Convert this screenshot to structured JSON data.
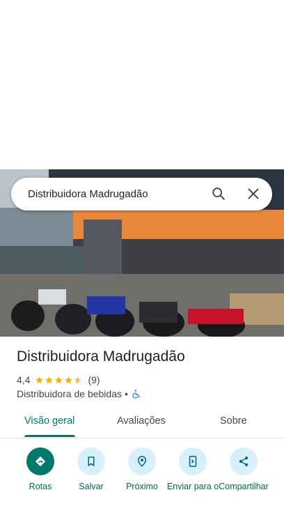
{
  "search": {
    "query": "Distribuidora Madrugadão"
  },
  "place": {
    "title": "Distribuidora Madrugadão",
    "rating_value": "4,4",
    "rating_stars": 4.4,
    "review_count": "(9)",
    "category": "Distribuidora de bebidas",
    "separator": "•"
  },
  "tabs": [
    {
      "label": "Visão geral",
      "active": true
    },
    {
      "label": "Avaliações",
      "active": false
    },
    {
      "label": "Sobre",
      "active": false
    }
  ],
  "actions": [
    {
      "label": "Rotas",
      "icon": "directions-icon"
    },
    {
      "label": "Salvar",
      "icon": "bookmark-icon"
    },
    {
      "label": "Próximo",
      "icon": "nearby-icon"
    },
    {
      "label": "Enviar para o",
      "icon": "send-to-phone-icon"
    },
    {
      "label": "Compartilhar",
      "icon": "share-icon"
    }
  ],
  "colors": {
    "accent": "#00796b",
    "action_bg": "#d7f0fb",
    "star": "#f4b400",
    "wheelchair": "#1a73e8"
  }
}
